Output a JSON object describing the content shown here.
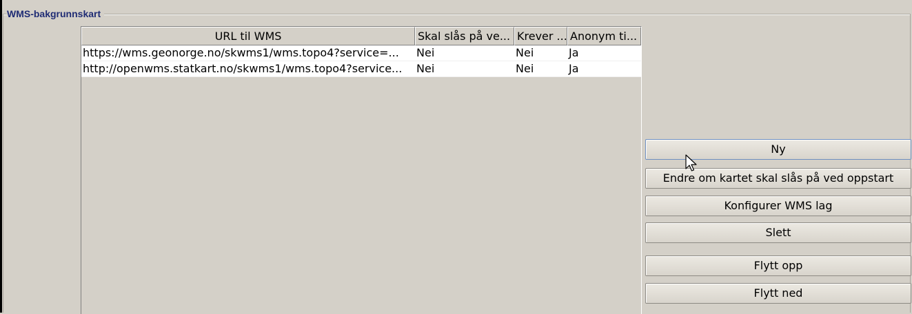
{
  "group": {
    "title": "WMS-bakgrunnskart"
  },
  "table": {
    "columns": [
      "URL til WMS",
      "Skal slås på ve...",
      "Krever ...",
      "Anonym ti..."
    ],
    "rows": [
      [
        "https://wms.geonorge.no/skwms1/wms.topo4?service=...",
        "Nei",
        "Nei",
        "Ja"
      ],
      [
        "http://openwms.statkart.no/skwms1/wms.topo4?service...",
        "Nei",
        "Nei",
        "Ja"
      ]
    ]
  },
  "buttons": {
    "new": "Ny",
    "toggle_startup": "Endre om kartet skal slås på ved oppstart",
    "configure_layers": "Konfigurer WMS lag",
    "delete": "Slett",
    "move_up": "Flytt opp",
    "move_down": "Flytt ned"
  },
  "colors": {
    "group_title": "#1f2c74",
    "background": "#d4d0c8",
    "focus_border": "#6e8fc0"
  }
}
